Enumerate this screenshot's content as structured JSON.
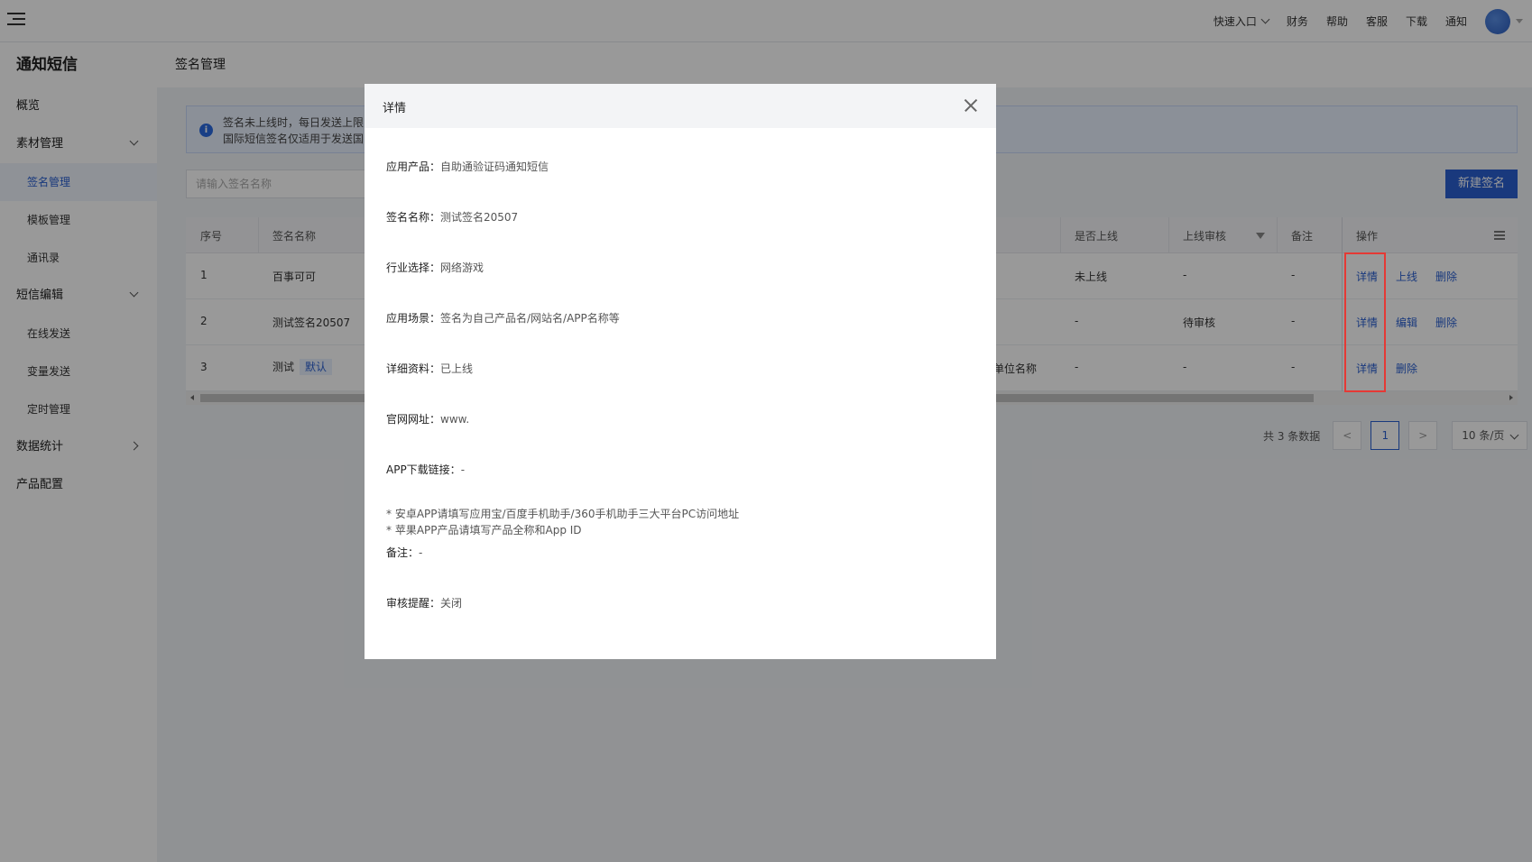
{
  "topbar": {
    "quick_entry": "快速入口",
    "finance": "财务",
    "help": "帮助",
    "service": "客服",
    "download": "下载",
    "notify": "通知"
  },
  "sidebar": {
    "title": "通知短信",
    "overview": "概览",
    "material": "素材管理",
    "signature": "签名管理",
    "template": "模板管理",
    "contacts": "通讯录",
    "sms_edit": "短信编辑",
    "online_send": "在线发送",
    "variable_send": "变量发送",
    "scheduled": "定时管理",
    "stats": "数据统计",
    "product_config": "产品配置"
  },
  "main": {
    "page_title": "签名管理",
    "notice_line1": "签名未上线时，每日发送上限",
    "notice_line2": "国际短信签名仅适用于发送国",
    "search_placeholder": "请输入签名名称",
    "new_button": "新建签名"
  },
  "table": {
    "headers": {
      "index": "序号",
      "name": "签名名称",
      "online": "是否上线",
      "review": "上线审核",
      "remark": "备注",
      "action": "操作"
    },
    "rows": [
      {
        "index": "1",
        "name": "百事可可",
        "extra": "",
        "online": "未上线",
        "review": "-",
        "remark": "-",
        "actions": [
          "详情",
          "上线",
          "删除"
        ]
      },
      {
        "index": "2",
        "name": "测试签名20507",
        "extra": "",
        "online": "-",
        "review": "待审核",
        "remark": "-",
        "actions": [
          "详情",
          "编辑",
          "删除"
        ]
      },
      {
        "index": "3",
        "name": "测试",
        "tag": "默认",
        "extra": "单位名称",
        "online": "-",
        "review": "-",
        "remark": "-",
        "actions": [
          "详情",
          "删除"
        ]
      }
    ]
  },
  "pager": {
    "total": "共 3 条数据",
    "prev": "<",
    "page": "1",
    "next": ">",
    "size": "10 条/页"
  },
  "modal": {
    "title": "详情",
    "fields": [
      {
        "label": "应用产品：",
        "value": "自助通验证码通知短信"
      },
      {
        "label": "签名名称：",
        "value": "测试签名20507"
      },
      {
        "label": "行业选择：",
        "value": "网络游戏"
      },
      {
        "label": "应用场景：",
        "value": "签名为自己产品名/网站名/APP名称等"
      },
      {
        "label": "详细资料：",
        "value": "已上线"
      },
      {
        "label": "官网网址：",
        "value": "www."
      },
      {
        "label": "APP下载链接：",
        "value": "-"
      }
    ],
    "hint1": "* 安卓APP请填写应用宝/百度手机助手/360手机助手三大平台PC访问地址",
    "hint2": "* 苹果APP产品请填写产品全称和App ID",
    "remark_label": "备注：",
    "remark_value": "-",
    "audit_label": "审核提醒：",
    "audit_value": "关闭"
  }
}
